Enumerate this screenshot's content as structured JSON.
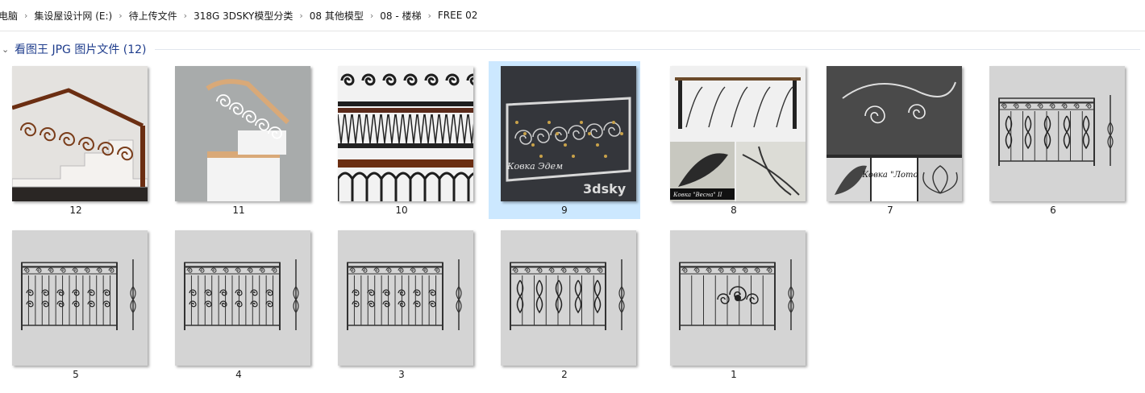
{
  "breadcrumb": [
    "电脑",
    "集设屋设计网 (E:)",
    "待上传文件",
    "318G 3DSKY模型分类",
    "08 其他模型",
    "08 - 楼梯",
    "FREE 02"
  ],
  "breadcrumb_separator": "›",
  "group": {
    "title": "看图王 JPG 图片文件 (12)",
    "chevron_icon": "chevron-down-icon"
  },
  "files": [
    {
      "name": "12",
      "thumb": "stair-render-copper"
    },
    {
      "name": "11",
      "thumb": "stair-render-white"
    },
    {
      "name": "10",
      "thumb": "railing-photo-dark"
    },
    {
      "name": "9",
      "thumb": "railing-render-gold",
      "selected": true,
      "overlay_text": "Ковка Эдем",
      "brand": "3dsky"
    },
    {
      "name": "8",
      "thumb": "railing-collage-leaves",
      "overlay_text": "Ковка \"Весна\" II"
    },
    {
      "name": "7",
      "thumb": "railing-collage-lotus",
      "overlay_text": "Ковка \"Лотос\""
    },
    {
      "name": "6",
      "thumb": "railing-drawing-scroll"
    },
    {
      "name": "5",
      "thumb": "railing-drawing-dense"
    },
    {
      "name": "4",
      "thumb": "railing-drawing-dense"
    },
    {
      "name": "3",
      "thumb": "railing-drawing-dense"
    },
    {
      "name": "2",
      "thumb": "railing-drawing-scroll"
    },
    {
      "name": "1",
      "thumb": "railing-drawing-center"
    }
  ],
  "colors": {
    "selection": "#cce8ff",
    "group_title": "#1e3c8c",
    "drawing_bg": "#d4d4d4",
    "iron": "#3a3a3a"
  }
}
